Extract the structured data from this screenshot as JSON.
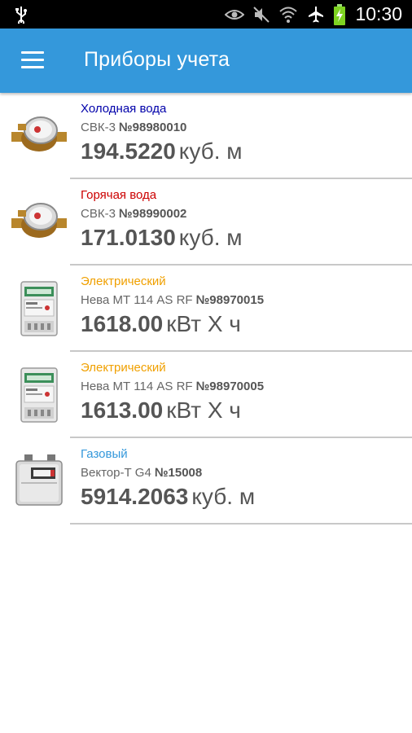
{
  "status_bar": {
    "time": "10:30",
    "icons": [
      "usb-icon",
      "eye-icon",
      "mute-icon",
      "wifi-icon",
      "airplane-icon",
      "battery-charging-icon"
    ]
  },
  "app_bar": {
    "title": "Приборы учета",
    "menu_icon": "hamburger-menu-icon",
    "color": "#3498db"
  },
  "meters": [
    {
      "type": "Холодная вода",
      "type_color": "#0000aa",
      "model": "СВК-3",
      "serial": "№98980010",
      "reading": "194.5220",
      "unit": "куб. м",
      "icon": "water-meter-icon"
    },
    {
      "type": "Горячая вода",
      "type_color": "#cc0000",
      "model": "СВК-3",
      "serial": "№98990002",
      "reading": "171.0130",
      "unit": "куб. м",
      "icon": "water-meter-icon"
    },
    {
      "type": "Электрический",
      "type_color": "#f0a000",
      "model": "Нева МТ 114 AS RF",
      "serial": "№98970015",
      "reading": "1618.00",
      "unit": "кВт Х ч",
      "icon": "electric-meter-icon"
    },
    {
      "type": "Электрический",
      "type_color": "#f0a000",
      "model": "Нева МТ 114 AS RF",
      "serial": "№98970005",
      "reading": "1613.00",
      "unit": "кВт Х ч",
      "icon": "electric-meter-icon"
    },
    {
      "type": "Газовый",
      "type_color": "#3498db",
      "model": "Вектор-Т G4",
      "serial": "№15008",
      "reading": "5914.2063",
      "unit": "куб. м",
      "icon": "gas-meter-icon"
    }
  ]
}
